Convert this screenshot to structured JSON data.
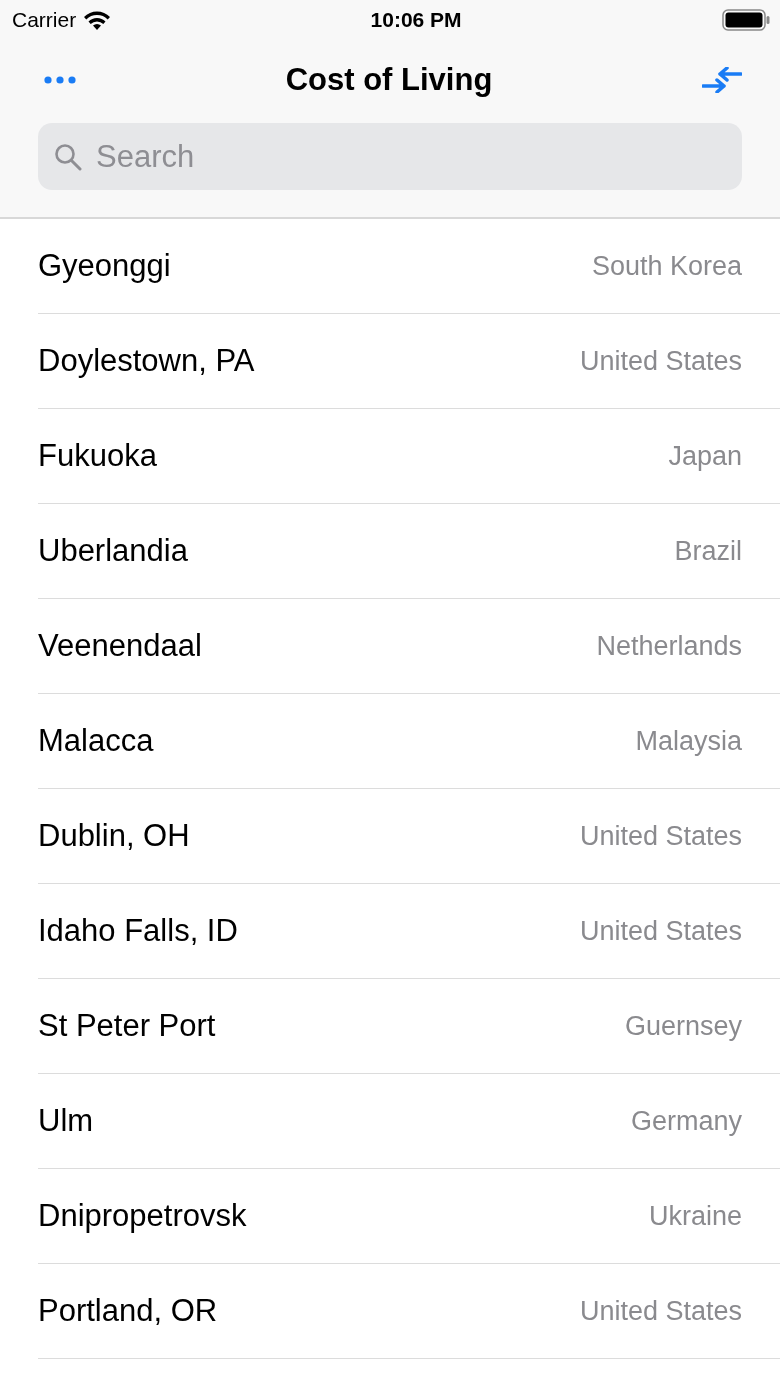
{
  "status_bar": {
    "carrier": "Carrier",
    "time": "10:06 PM"
  },
  "nav": {
    "title": "Cost of Living"
  },
  "search": {
    "placeholder": "Search"
  },
  "rows": [
    {
      "city": "Gyeonggi",
      "country": "South Korea"
    },
    {
      "city": "Doylestown, PA",
      "country": "United States"
    },
    {
      "city": "Fukuoka",
      "country": "Japan"
    },
    {
      "city": "Uberlandia",
      "country": "Brazil"
    },
    {
      "city": "Veenendaal",
      "country": "Netherlands"
    },
    {
      "city": "Malacca",
      "country": "Malaysia"
    },
    {
      "city": "Dublin, OH",
      "country": "United States"
    },
    {
      "city": "Idaho Falls, ID",
      "country": "United States"
    },
    {
      "city": "St Peter Port",
      "country": "Guernsey"
    },
    {
      "city": "Ulm",
      "country": "Germany"
    },
    {
      "city": "Dnipropetrovsk",
      "country": "Ukraine"
    },
    {
      "city": "Portland, OR",
      "country": "United States"
    }
  ]
}
